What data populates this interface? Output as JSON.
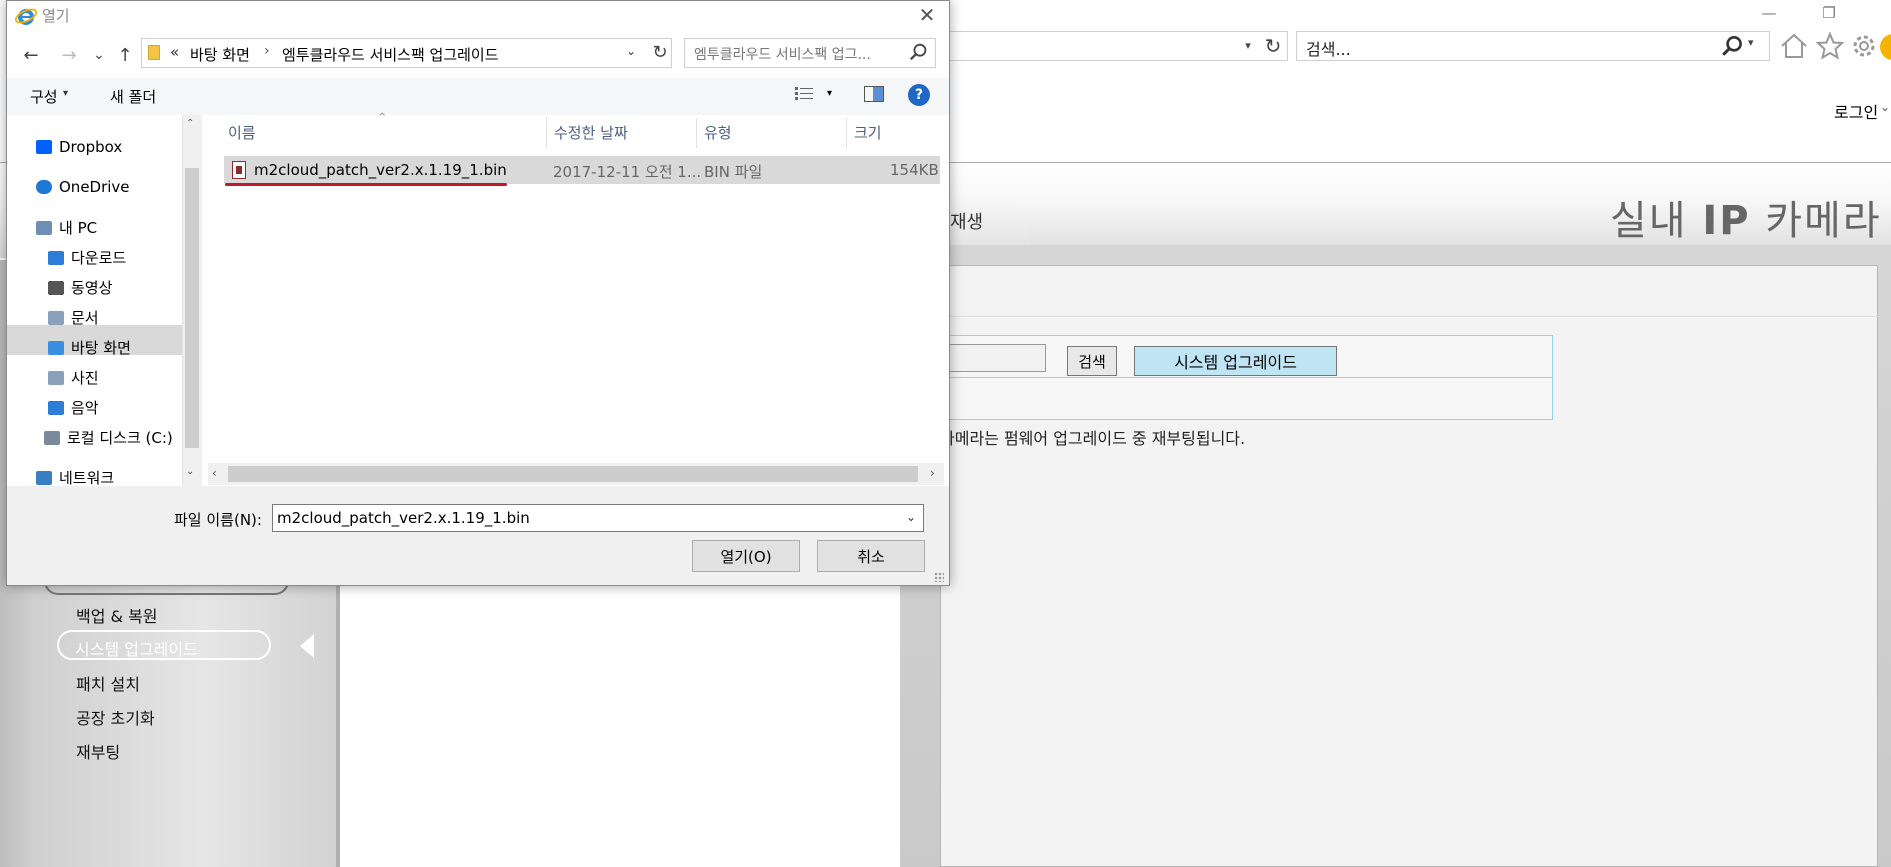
{
  "browser": {
    "search_placeholder": "검색...",
    "login_label": "로그인",
    "login_caret": "⌄",
    "restore_glyph": "❐",
    "minimize_glyph": "—",
    "address_dropdown": "▾",
    "address_refresh": "↻",
    "search_dropdown": "▾",
    "icons": [
      "home-icon",
      "favorites-star-icon",
      "settings-gear-icon"
    ]
  },
  "page": {
    "tab_label": "재생",
    "camera_title_prefix": "실내 ",
    "camera_title_bold": "IP",
    "camera_title_suffix": " 카메라",
    "search_button": "검색",
    "system_upgrade_button": "시스템 업그레이드",
    "notice": "카메라는 펌웨어 업그레이드 중 재부팅됩니다.",
    "sidebar": {
      "partial_item": "",
      "items": [
        "백업 & 복원",
        "시스템 업그레이드",
        "패치 설치",
        "공장 초기화",
        "재부팅"
      ],
      "active_index": 1
    }
  },
  "dialog": {
    "title": "열기",
    "close_glyph": "✕",
    "nav": {
      "back": "←",
      "forward": "→",
      "recent": "⌄",
      "up": "↑"
    },
    "breadcrumb": {
      "overflow": "«",
      "items": [
        "바탕 화면",
        "엠투클라우드 서비스팩 업그레이드"
      ],
      "separator": "›",
      "dropdown": "⌄",
      "refresh": "↻"
    },
    "search_placeholder": "엠투클라우드 서비스팩 업그...",
    "toolbar": {
      "organize": "구성",
      "organize_caret": "▾",
      "new_folder": "새 폴더",
      "view_caret": "▾",
      "help": "?"
    },
    "tree": {
      "scroll_up": "⌃",
      "scroll_down": "⌄",
      "items": [
        {
          "label": "Dropbox",
          "icon": "dropbox-icon",
          "color": "#0061fe"
        },
        {
          "label": "OneDrive",
          "icon": "onedrive-cloud-icon",
          "color": "#1e78d6"
        },
        {
          "label": "내 PC",
          "icon": "computer-icon",
          "color": "#6f8fb5"
        },
        {
          "label": "다운로드",
          "icon": "downloads-folder-icon",
          "color": "#2b7dd6"
        },
        {
          "label": "동영상",
          "icon": "videos-folder-icon",
          "color": "#555555"
        },
        {
          "label": "문서",
          "icon": "documents-folder-icon",
          "color": "#8aa0bb"
        },
        {
          "label": "바탕 화면",
          "icon": "desktop-folder-icon",
          "color": "#3a8fe0"
        },
        {
          "label": "사진",
          "icon": "pictures-folder-icon",
          "color": "#8aa0bb"
        },
        {
          "label": "음악",
          "icon": "music-folder-icon",
          "color": "#2b7dd6"
        },
        {
          "label": "로컬 디스크 (C:)",
          "icon": "local-disk-icon",
          "color": "#7b8a9a"
        },
        {
          "label": "네트워크",
          "icon": "network-icon",
          "color": "#3a7fc5"
        }
      ],
      "selected_index": 6
    },
    "columns": [
      "이름",
      "수정한 날짜",
      "유형",
      "크기"
    ],
    "sort_glyph": "^",
    "files": [
      {
        "name": "m2cloud_patch_ver2.x.1.19_1.bin",
        "modified": "2017-12-11 오전 1...",
        "type": "BIN 파일",
        "size": "154KB"
      }
    ],
    "hscroll": {
      "left": "‹",
      "right": "›"
    },
    "filename_label": "파일 이름(N):",
    "filename_value": "m2cloud_patch_ver2.x.1.19_1.bin",
    "filename_dropdown": "⌄",
    "open_button": "열기(O)",
    "cancel_button": "취소"
  }
}
